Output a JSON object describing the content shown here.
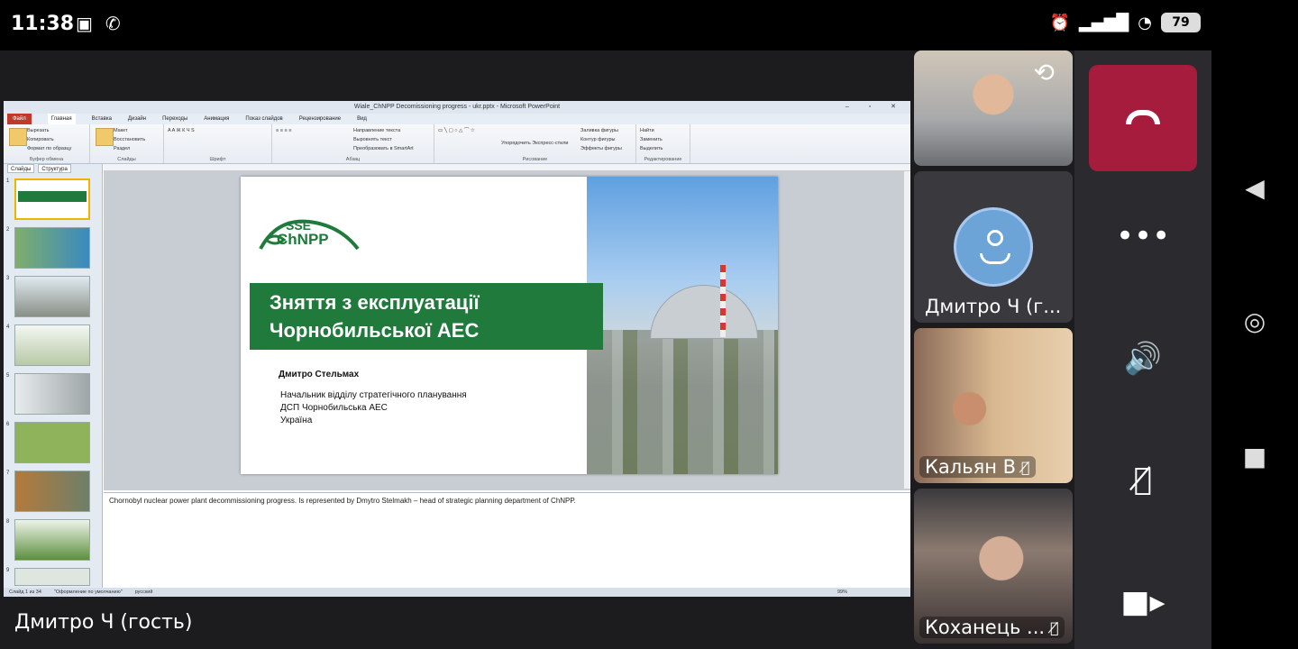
{
  "status_bar": {
    "time": "11:38",
    "left_icons": [
      "teams-notification-icon",
      "phone-icon"
    ],
    "right_icons": [
      "alarm-icon",
      "signal-icon",
      "wifi-icon"
    ],
    "battery": "79"
  },
  "powerpoint": {
    "window_title": "Wiale_ChNPP Decomissioning progress - ukr.pptx - Microsoft PowerPoint",
    "tabs": [
      "Файл",
      "Главная",
      "Вставка",
      "Дизайн",
      "Переходы",
      "Анимация",
      "Показ слайдов",
      "Рецензирование",
      "Вид"
    ],
    "ribbon_groups": {
      "clipboard": {
        "name": "Буфер обмена",
        "items": [
          "Вставить",
          "Вырезать",
          "Копировать",
          "Формат по образцу"
        ]
      },
      "slides": {
        "name": "Слайды",
        "items": [
          "Создать слайд",
          "Макет",
          "Восстановить",
          "Раздел"
        ]
      },
      "font": {
        "name": "Шрифт"
      },
      "paragraph": {
        "name": "Абзац",
        "items": [
          "Направление текста",
          "Выровнять текст",
          "Преобразовать в SmartArt"
        ]
      },
      "drawing": {
        "name": "Рисование",
        "items": [
          "Упорядочить",
          "Экспресс-стили",
          "Заливка фигуры",
          "Контур фигуры",
          "Эффекты фигуры"
        ]
      },
      "editing": {
        "name": "Редактирование",
        "items": [
          "Найти",
          "Заменить",
          "Выделить"
        ]
      }
    },
    "panel_tabs": [
      "Слайды",
      "Структура"
    ],
    "slide_numbers": [
      "1",
      "2",
      "3",
      "4",
      "5",
      "6",
      "7",
      "8",
      "9"
    ],
    "slide": {
      "logo_sse": "SSE",
      "logo_chnpp": "ChNPP",
      "title_line1": "Зняття з експлуатації",
      "title_line2": "Чорнобильської АЕС",
      "speaker": "Дмитро Стельмах",
      "position": "Начальник відділу стратегічного планування",
      "organization": "ДСП Чорнобильська АЕС",
      "country": "Україна"
    },
    "notes": "Chornobyl nuclear power plant decommissioning progress. Is represented by Dmytro Stelmakh – head of strategic planning department of ChNPP.",
    "status": {
      "slide_counter": "Слайд 1 из 34",
      "theme": "\"Оформление по умолчанию\"",
      "language": "русский",
      "zoom": "99%"
    }
  },
  "meeting": {
    "presenter_label": "Дмитро Ч (гость)",
    "participants": [
      {
        "name": "",
        "video": true
      },
      {
        "name": "Дмитро Ч (г...",
        "video": false
      },
      {
        "name": "Кальян В",
        "video": true,
        "muted": true
      },
      {
        "name": "Коханець ...",
        "video": true,
        "muted": true
      }
    ],
    "colors": {
      "hangup": "#a61c3c",
      "avatar": "#6ca4d8",
      "accent_green": "#1f7a3c"
    }
  },
  "controls": [
    "hang-up-icon",
    "more-options-icon",
    "speaker-icon",
    "microphone-muted-icon",
    "video-camera-icon"
  ],
  "nav_bar": [
    "back-icon",
    "home-icon",
    "recents-icon"
  ]
}
